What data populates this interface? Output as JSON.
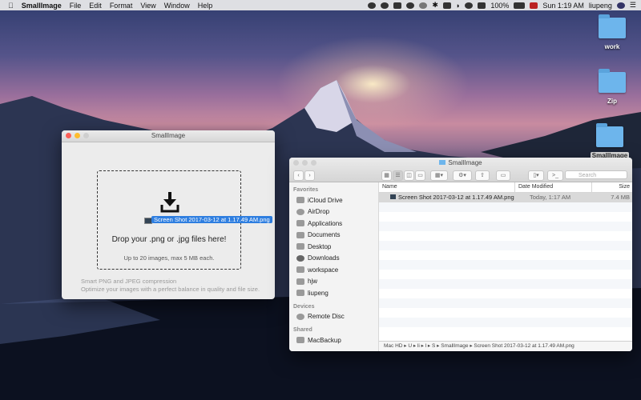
{
  "menubar": {
    "apple": "",
    "app_name": "SmallImage",
    "menus": [
      "File",
      "Edit",
      "Format",
      "View",
      "Window",
      "Help"
    ],
    "battery": "100%",
    "clock": "Sun 1:19 AM",
    "user": "liupeng"
  },
  "desktop_icons": [
    {
      "label": "work"
    },
    {
      "label": "Zip"
    },
    {
      "label": "SmallImage"
    }
  ],
  "smallimage_window": {
    "title": "SmallImage",
    "drag_file": "Screen Shot 2017-03-12 at 1.17.49 AM.png",
    "drop_title": "Drop your .png or .jpg files here!",
    "drop_subtitle": "Up to 20 images, max 5 MB each.",
    "footer_line1": "Smart PNG and JPEG compression",
    "footer_line2": "Optimize your images with a perfect balance in quality and file size."
  },
  "finder": {
    "title": "SmallImage",
    "search_placeholder": "Search",
    "favorites_header": "Favorites",
    "favorites": [
      {
        "label": "iCloud Drive",
        "icon": "cloud-icon"
      },
      {
        "label": "AirDrop",
        "icon": "airdrop-icon"
      },
      {
        "label": "Applications",
        "icon": "applications-icon"
      },
      {
        "label": "Documents",
        "icon": "documents-icon"
      },
      {
        "label": "Desktop",
        "icon": "desktop-icon"
      },
      {
        "label": "Downloads",
        "icon": "downloads-icon"
      },
      {
        "label": "workspace",
        "icon": "folder-icon"
      },
      {
        "label": "hjw",
        "icon": "folder-icon"
      },
      {
        "label": "liupeng",
        "icon": "home-icon"
      }
    ],
    "devices_header": "Devices",
    "devices": [
      {
        "label": "Remote Disc",
        "icon": "disc-icon"
      }
    ],
    "shared_header": "Shared",
    "shared": [
      {
        "label": "MacBackup",
        "icon": "server-icon"
      }
    ],
    "columns": {
      "name": "Name",
      "date": "Date Modified",
      "size": "Size"
    },
    "files": [
      {
        "name": "Screen Shot 2017-03-12 at 1.17.49 AM.png",
        "date": "Today, 1:17 AM",
        "size": "7.4 MB"
      }
    ],
    "pathbar": "Mac HD ▸ U ▸ li ▸ l ▸ S ▸ SmallImage ▸ Screen Shot 2017-03-12 at 1.17.49 AM.png"
  }
}
